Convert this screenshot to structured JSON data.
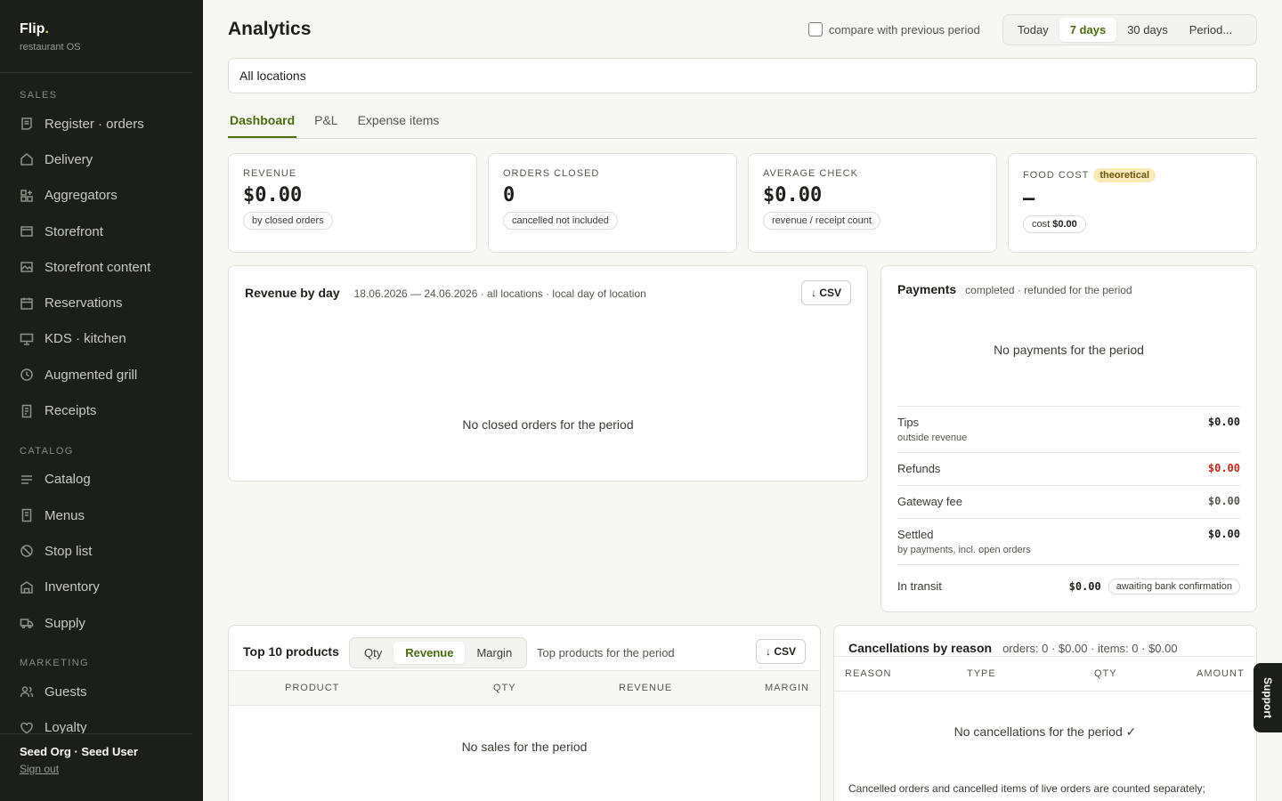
{
  "brand": {
    "name": "Flip",
    "dot": ".",
    "tagline": "restaurant OS"
  },
  "sidebar": {
    "sections": [
      {
        "label": "SALES",
        "items": [
          {
            "label": "Register · orders",
            "icon": "receipt-list-icon"
          },
          {
            "label": "Delivery",
            "icon": "home-icon"
          },
          {
            "label": "Aggregators",
            "icon": "grid-plus-icon"
          },
          {
            "label": "Storefront",
            "icon": "browser-icon"
          },
          {
            "label": "Storefront content",
            "icon": "image-icon"
          },
          {
            "label": "Reservations",
            "icon": "calendar-icon"
          },
          {
            "label": "KDS · kitchen",
            "icon": "monitor-icon"
          },
          {
            "label": "Augmented grill",
            "icon": "clock-icon"
          },
          {
            "label": "Receipts",
            "icon": "receipt-icon"
          }
        ]
      },
      {
        "label": "CATALOG",
        "items": [
          {
            "label": "Catalog",
            "icon": "list-icon"
          },
          {
            "label": "Menus",
            "icon": "menu-book-icon"
          },
          {
            "label": "Stop list",
            "icon": "ban-icon"
          },
          {
            "label": "Inventory",
            "icon": "warehouse-icon"
          },
          {
            "label": "Supply",
            "icon": "truck-icon"
          }
        ]
      },
      {
        "label": "MARKETING",
        "items": [
          {
            "label": "Guests",
            "icon": "users-icon"
          },
          {
            "label": "Loyalty",
            "icon": "heart-icon"
          }
        ]
      }
    ],
    "footer": {
      "user": "Seed Org · Seed User",
      "signout": "Sign out"
    }
  },
  "header": {
    "title": "Analytics",
    "compare_label": "compare with previous period",
    "periods": [
      "Today",
      "7 days",
      "30 days",
      "Period..."
    ],
    "active_period": "7 days"
  },
  "location_select": {
    "value": "All locations"
  },
  "tabs": [
    "Dashboard",
    "P&L",
    "Expense items"
  ],
  "kpis": [
    {
      "label": "REVENUE",
      "value": "$0.00",
      "note": "by closed orders"
    },
    {
      "label": "ORDERS CLOSED",
      "value": "0",
      "note": "cancelled not included"
    },
    {
      "label": "AVERAGE CHECK",
      "value": "$0.00",
      "note": "revenue / receipt count"
    },
    {
      "label": "FOOD COST",
      "badge": "theoretical",
      "value": "—",
      "note_prefix": "cost",
      "note_value": "$0.00"
    }
  ],
  "revenue_by_day": {
    "title": "Revenue by day",
    "subtitle": "18.06.2026 — 24.06.2026 · all locations · local day of location",
    "csv": "↓ CSV",
    "empty": "No closed orders for the period"
  },
  "payments": {
    "title": "Payments",
    "subtitle": "completed · refunded for the period",
    "empty": "No payments for the period",
    "rows": [
      {
        "label": "Tips",
        "sub": "outside revenue",
        "amount": "$0.00"
      },
      {
        "label": "Refunds",
        "amount": "$0.00"
      },
      {
        "label": "Gateway fee",
        "amount": "$0.00"
      },
      {
        "label": "Settled",
        "sub": "by payments, incl. open orders",
        "amount": "$0.00"
      },
      {
        "label": "In transit",
        "amount": "$0.00",
        "badge": "awaiting bank confirmation"
      }
    ]
  },
  "top_products": {
    "title": "Top 10 products",
    "modes": [
      "Qty",
      "Revenue",
      "Margin"
    ],
    "active_mode": "Revenue",
    "subtitle": "Top products for the period",
    "csv": "↓ CSV",
    "columns": [
      "PRODUCT",
      "QTY",
      "REVENUE",
      "MARGIN"
    ],
    "empty": "No sales for the period"
  },
  "cancellations": {
    "title": "Cancellations by reason",
    "summary": "orders: 0 · $0.00 · items: 0 · $0.00",
    "columns": [
      "REASON",
      "TYPE",
      "QTY",
      "AMOUNT"
    ],
    "empty": "No cancellations for the period ✓",
    "note": "Cancelled orders and cancelled items of live orders are counted separately;"
  },
  "support": {
    "label": "Support"
  },
  "colors": {
    "accent": "#4a6b0e",
    "sidebar_bg": "#1c1e19",
    "refund_red": "#c6261b",
    "badge_yellow": "#faeab8"
  }
}
